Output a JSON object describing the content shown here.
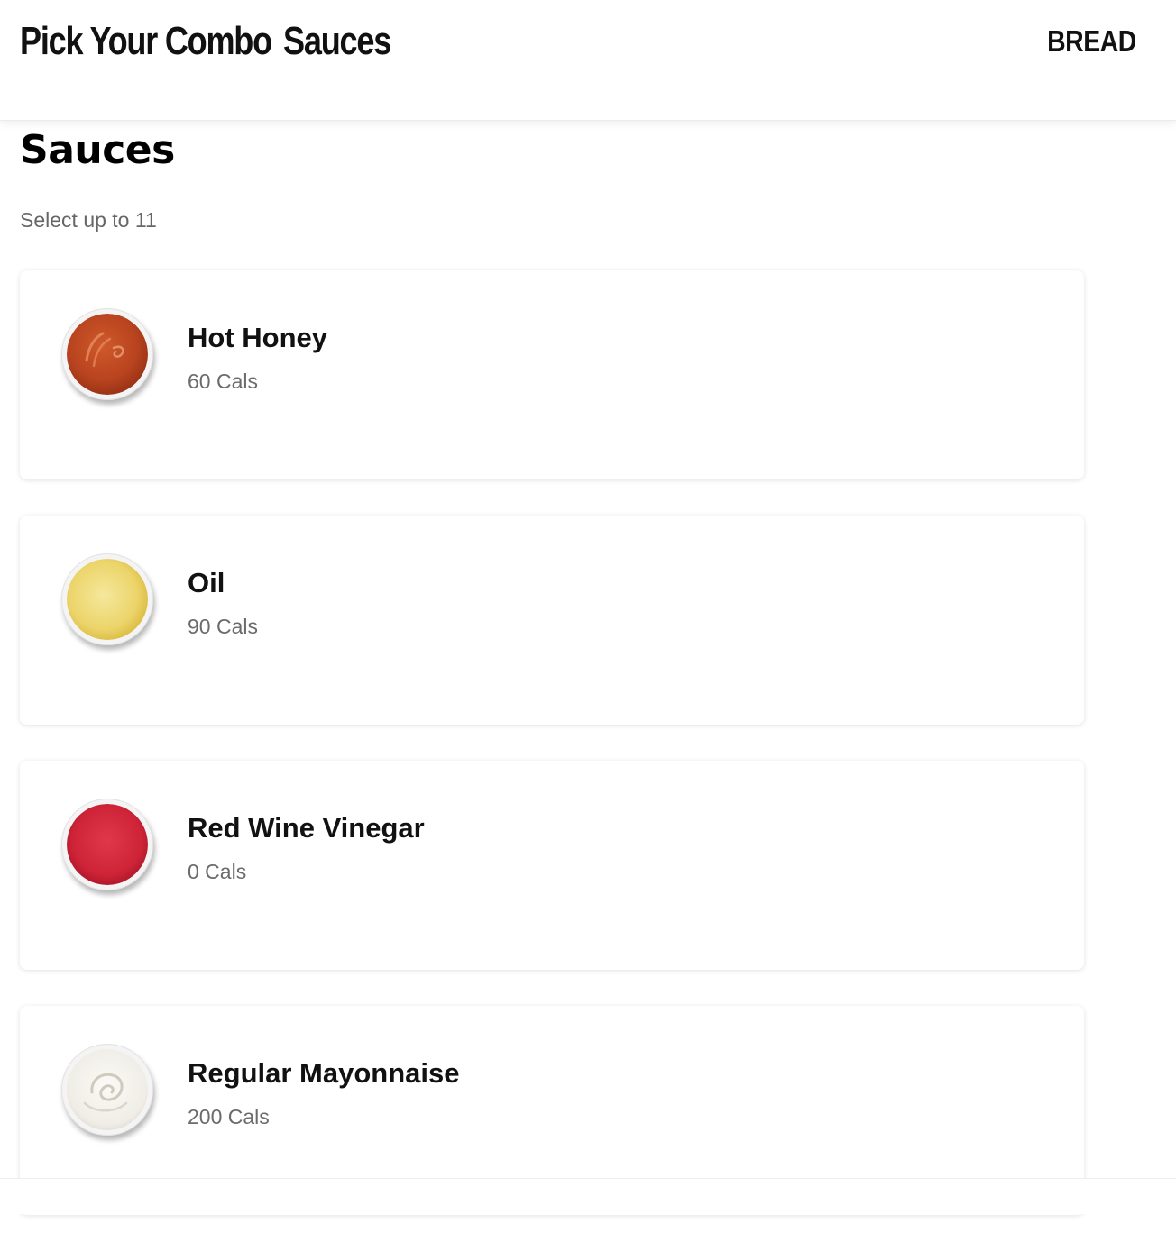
{
  "header": {
    "title_part1": "Pick Your Combo",
    "title_part2": "Sauces",
    "right_link": "BREAD"
  },
  "section": {
    "title": "Sauces",
    "subtitle": "Select up to 11"
  },
  "items": [
    {
      "name": "Hot Honey",
      "cals": "60 Cals",
      "color": "#b8431f",
      "image_icon": "hot-honey-sauce-icon"
    },
    {
      "name": "Oil",
      "cals": "90 Cals",
      "color": "#ecd46a",
      "image_icon": "oil-sauce-icon"
    },
    {
      "name": "Red Wine Vinegar",
      "cals": "0 Cals",
      "color": "#cf2438",
      "image_icon": "red-wine-vinegar-sauce-icon"
    },
    {
      "name": "Regular Mayonnaise",
      "cals": "200 Cals",
      "color": "#efede6",
      "image_icon": "mayonnaise-sauce-icon"
    }
  ]
}
